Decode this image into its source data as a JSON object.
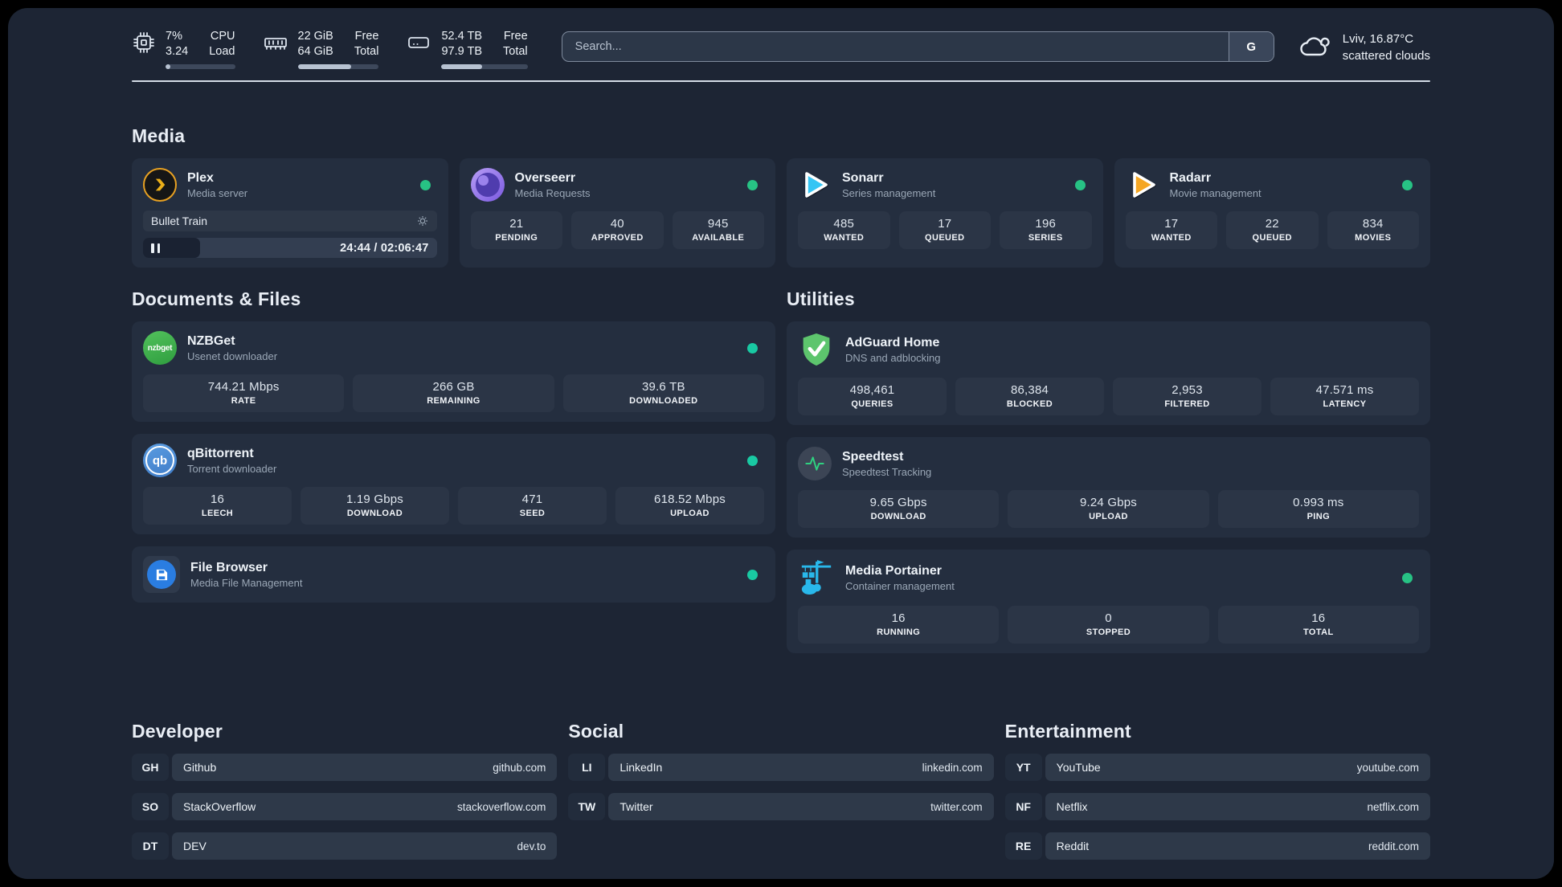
{
  "topbar": {
    "cpu": {
      "percent": "7%",
      "load": "3.24",
      "label_top": "CPU",
      "label_bottom": "Load",
      "progress_pct": 7
    },
    "memory": {
      "free": "22 GiB",
      "total": "64 GiB",
      "label_top": "Free",
      "label_bottom": "Total",
      "progress_pct": 66
    },
    "disk": {
      "free": "52.4 TB",
      "total": "97.9 TB",
      "label_top": "Free",
      "label_bottom": "Total",
      "progress_pct": 47
    },
    "search": {
      "placeholder": "Search...",
      "engine_button": "G"
    },
    "weather": {
      "location_temp": "Lviv, 16.87°C",
      "condition": "scattered clouds"
    }
  },
  "sections": {
    "media": "Media",
    "documents": "Documents & Files",
    "utilities": "Utilities",
    "developer": "Developer",
    "social": "Social",
    "entertainment": "Entertainment"
  },
  "services": {
    "plex": {
      "name": "Plex",
      "desc": "Media server",
      "now_playing": "Bullet Train",
      "elapsed_total": "24:44 / 02:06:47",
      "progress_pct": 19.5
    },
    "overseerr": {
      "name": "Overseerr",
      "desc": "Media Requests",
      "stats": [
        {
          "value": "21",
          "label": "PENDING"
        },
        {
          "value": "40",
          "label": "APPROVED"
        },
        {
          "value": "945",
          "label": "AVAILABLE"
        }
      ]
    },
    "sonarr": {
      "name": "Sonarr",
      "desc": "Series management",
      "stats": [
        {
          "value": "485",
          "label": "WANTED"
        },
        {
          "value": "17",
          "label": "QUEUED"
        },
        {
          "value": "196",
          "label": "SERIES"
        }
      ]
    },
    "radarr": {
      "name": "Radarr",
      "desc": "Movie management",
      "stats": [
        {
          "value": "17",
          "label": "WANTED"
        },
        {
          "value": "22",
          "label": "QUEUED"
        },
        {
          "value": "834",
          "label": "MOVIES"
        }
      ]
    },
    "nzbget": {
      "name": "NZBGet",
      "desc": "Usenet downloader",
      "icon_text": "nzbget",
      "stats": [
        {
          "value": "744.21 Mbps",
          "label": "RATE"
        },
        {
          "value": "266 GB",
          "label": "REMAINING"
        },
        {
          "value": "39.6 TB",
          "label": "DOWNLOADED"
        }
      ]
    },
    "qbittorrent": {
      "name": "qBittorrent",
      "desc": "Torrent downloader",
      "icon_text": "qb",
      "stats": [
        {
          "value": "16",
          "label": "LEECH"
        },
        {
          "value": "1.19 Gbps",
          "label": "DOWNLOAD"
        },
        {
          "value": "471",
          "label": "SEED"
        },
        {
          "value": "618.52 Mbps",
          "label": "UPLOAD"
        }
      ]
    },
    "filebrowser": {
      "name": "File Browser",
      "desc": "Media File Management"
    },
    "adguard": {
      "name": "AdGuard Home",
      "desc": "DNS and adblocking",
      "stats": [
        {
          "value": "498,461",
          "label": "QUERIES"
        },
        {
          "value": "86,384",
          "label": "BLOCKED"
        },
        {
          "value": "2,953",
          "label": "FILTERED"
        },
        {
          "value": "47.571 ms",
          "label": "LATENCY"
        }
      ]
    },
    "speedtest": {
      "name": "Speedtest",
      "desc": "Speedtest Tracking",
      "stats": [
        {
          "value": "9.65 Gbps",
          "label": "DOWNLOAD"
        },
        {
          "value": "9.24 Gbps",
          "label": "UPLOAD"
        },
        {
          "value": "0.993 ms",
          "label": "PING"
        }
      ]
    },
    "portainer": {
      "name": "Media Portainer",
      "desc": "Container management",
      "stats": [
        {
          "value": "16",
          "label": "RUNNING"
        },
        {
          "value": "0",
          "label": "STOPPED"
        },
        {
          "value": "16",
          "label": "TOTAL"
        }
      ]
    }
  },
  "bookmarks": {
    "developer": [
      {
        "abbr": "GH",
        "name": "Github",
        "url": "github.com"
      },
      {
        "abbr": "SO",
        "name": "StackOverflow",
        "url": "stackoverflow.com"
      },
      {
        "abbr": "DT",
        "name": "DEV",
        "url": "dev.to"
      }
    ],
    "social": [
      {
        "abbr": "LI",
        "name": "LinkedIn",
        "url": "linkedin.com"
      },
      {
        "abbr": "TW",
        "name": "Twitter",
        "url": "twitter.com"
      }
    ],
    "entertainment": [
      {
        "abbr": "YT",
        "name": "YouTube",
        "url": "youtube.com"
      },
      {
        "abbr": "NF",
        "name": "Netflix",
        "url": "netflix.com"
      },
      {
        "abbr": "RE",
        "name": "Reddit",
        "url": "reddit.com"
      }
    ]
  },
  "colors": {
    "background": "#1d2534",
    "card": "#242e3f",
    "tile": "#2b3546",
    "status_green": "#27c284",
    "status_teal": "#19c9a3",
    "plex_accent": "#ebaf19",
    "overseerr_accent": "#7b5ae0",
    "sonarr_accent": "#35c5f4",
    "radarr_accent": "#f5a623",
    "nzbget_accent": "#3db54a",
    "qbittorrent_accent": "#468ddf",
    "filebrowser_accent": "#2a7de1",
    "adguard_accent": "#5dc56d",
    "speedtest_accent": "#2fd180",
    "portainer_accent": "#29b8eb"
  }
}
